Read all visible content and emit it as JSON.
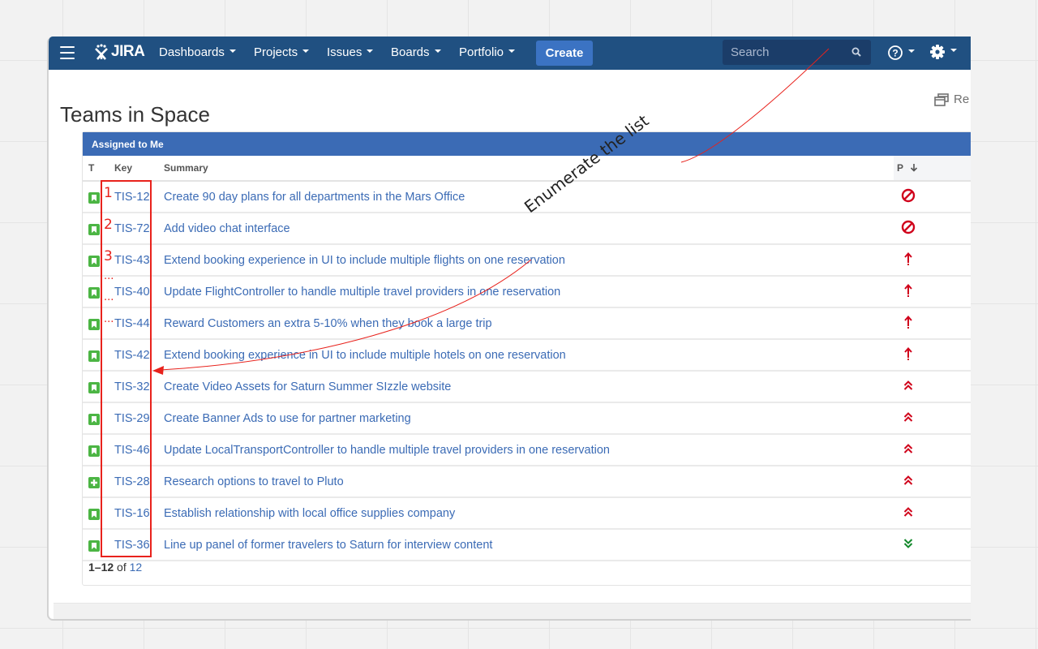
{
  "topnav": {
    "logo_text": "JIRA",
    "menu": [
      {
        "label": "Dashboards"
      },
      {
        "label": "Projects"
      },
      {
        "label": "Issues"
      },
      {
        "label": "Boards"
      },
      {
        "label": "Portfolio"
      }
    ],
    "create_label": "Create",
    "search_placeholder": "Search"
  },
  "page": {
    "title": "Teams in Space",
    "restore_label": "Re"
  },
  "gadget": {
    "title": "Assigned to Me",
    "columns": {
      "type": "T",
      "key": "Key",
      "summary": "Summary",
      "priority": "P"
    },
    "issues": [
      {
        "type": "story",
        "key": "TIS-12",
        "summary": "Create 90 day plans for all departments in the Mars Office",
        "priority": "blocker"
      },
      {
        "type": "story",
        "key": "TIS-72",
        "summary": "Add video chat interface",
        "priority": "blocker"
      },
      {
        "type": "story",
        "key": "TIS-43",
        "summary": "Extend booking experience in UI to include multiple flights on one reservation",
        "priority": "critical"
      },
      {
        "type": "story",
        "key": "TIS-40",
        "summary": "Update FlightController to handle multiple travel providers in one reservation",
        "priority": "critical"
      },
      {
        "type": "story",
        "key": "TIS-44",
        "summary": "Reward Customers an extra 5-10% when they book a large trip",
        "priority": "critical"
      },
      {
        "type": "story",
        "key": "TIS-42",
        "summary": "Extend booking experience in UI to include multiple hotels on one reservation",
        "priority": "critical"
      },
      {
        "type": "story",
        "key": "TIS-32",
        "summary": "Create Video Assets for Saturn Summer SIzzle website",
        "priority": "major"
      },
      {
        "type": "story",
        "key": "TIS-29",
        "summary": "Create Banner Ads to use for partner marketing",
        "priority": "major"
      },
      {
        "type": "story",
        "key": "TIS-46",
        "summary": "Update LocalTransportController to handle multiple travel providers in one reservation",
        "priority": "major"
      },
      {
        "type": "new-feature",
        "key": "TIS-28",
        "summary": "Research options to travel to Pluto",
        "priority": "major"
      },
      {
        "type": "story",
        "key": "TIS-16",
        "summary": "Establish relationship with local office supplies company",
        "priority": "major"
      },
      {
        "type": "story",
        "key": "TIS-36",
        "summary": "Line up panel of former travelers to Saturn for interview content",
        "priority": "minor"
      }
    ],
    "pagination": {
      "range": "1–12",
      "of_label": "of",
      "total": "12"
    }
  },
  "annotation": {
    "text": "Enumerate the list",
    "numbers": [
      "1",
      "2",
      "3",
      "...",
      "...",
      "..."
    ],
    "color": "#e8221c"
  },
  "colors": {
    "nav_bg": "#205081",
    "header_blue": "#3b6bb5",
    "link": "#3b6bb5",
    "story_green": "#4cb544",
    "priority_red": "#d04437",
    "priority_green": "#14892c"
  }
}
